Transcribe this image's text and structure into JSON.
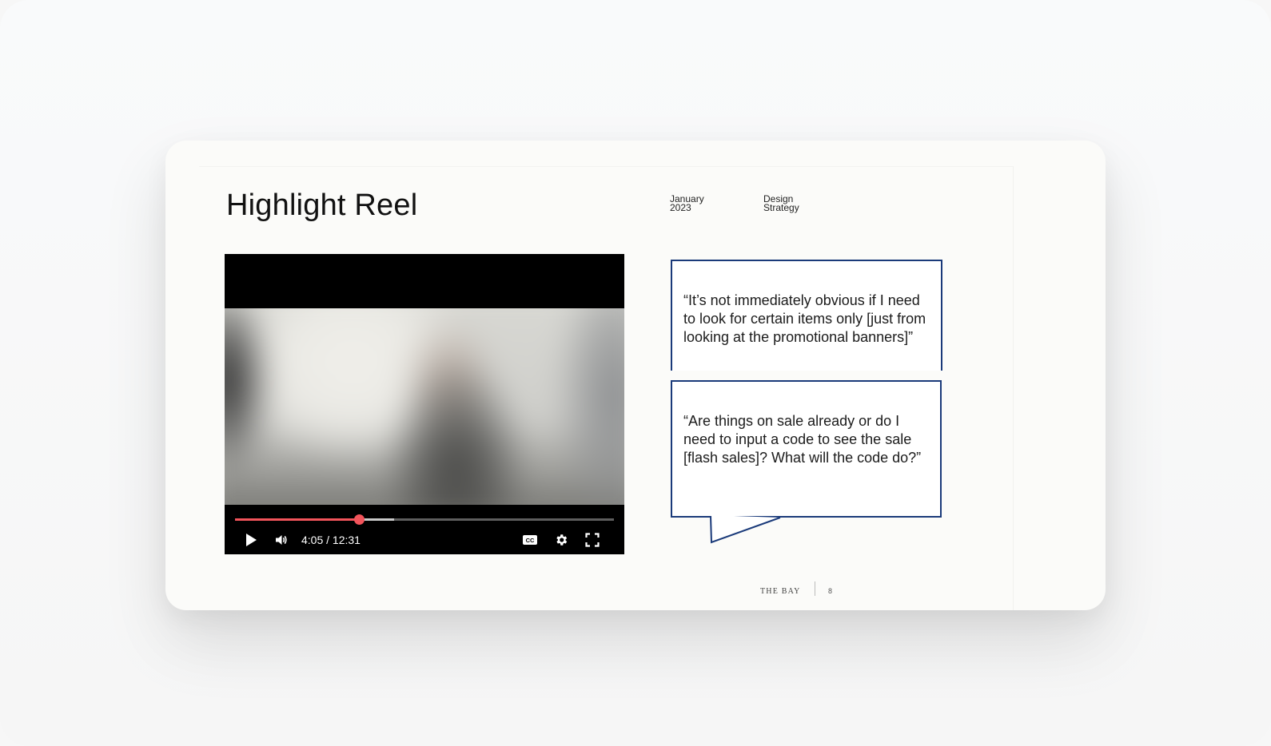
{
  "slide": {
    "title": "Highlight Reel",
    "date": "January\n2023",
    "department": "Design\nStrategy"
  },
  "video_player": {
    "current_time": "4:05",
    "duration": "12:31",
    "time_display": "4:05 / 12:31",
    "played_fraction": 0.326,
    "buffered_fraction": 0.42,
    "icons": {
      "play": "play-icon",
      "volume": "volume-icon",
      "captions": "closed-captions-icon",
      "settings": "gear-icon",
      "fullscreen": "fullscreen-icon"
    },
    "captions_label": "CC",
    "accent_color": "#f2545b"
  },
  "quotes": [
    {
      "text": "“It’s not immediately obvious if I need to look for certain items only [just from looking at the promotional banners]”"
    },
    {
      "text": "“Are things on sale already or do I need to input a code to see the sale [flash sales]? What will the code do?”"
    }
  ],
  "footer": {
    "brand": "THE BAY",
    "page_number": "8"
  },
  "colors": {
    "quote_border": "#1a3a7a",
    "slide_background": "#fbfbf9"
  }
}
